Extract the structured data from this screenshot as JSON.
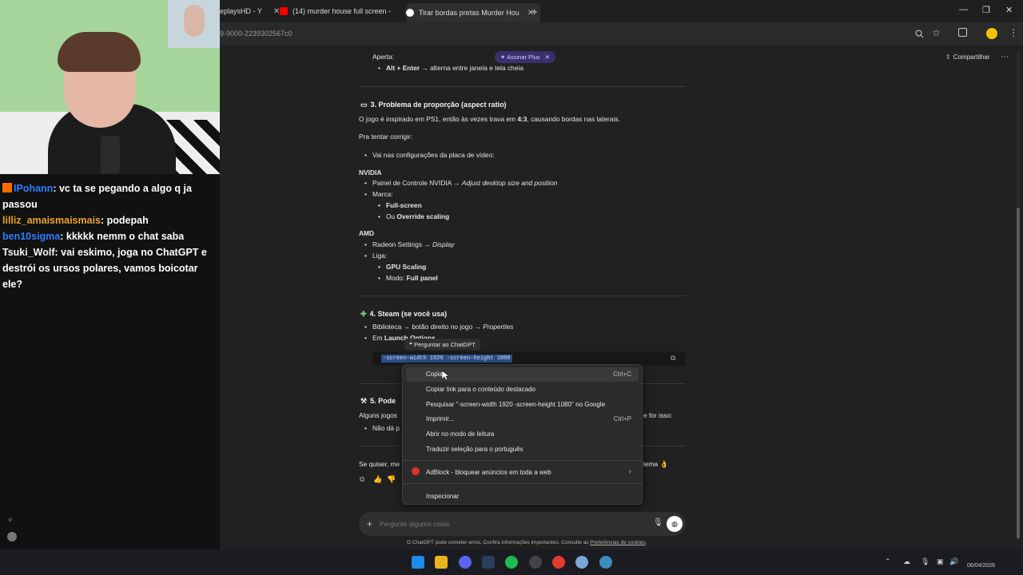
{
  "browser": {
    "tabs": [
      {
        "label": "eplaysHD - Y",
        "close": "✕"
      },
      {
        "label": "(14) murder house full screen -",
        "close": "✕"
      },
      {
        "label": "Tirar bordas pretas Murder Hou",
        "close": "✕"
      }
    ],
    "new_tab": "+",
    "url": "9-9000-2239302567c0",
    "window": {
      "minimize": "—",
      "restore": "❐",
      "close": "✕"
    }
  },
  "header": {
    "plus_pill": "✦ Assinar Plus",
    "plus_close": "✕",
    "share": "Compartilhar",
    "more": "⋯"
  },
  "content": {
    "aperta": "Aperta:",
    "alt_enter_keys": "Alt + Enter",
    "alt_enter_rest": " → alterna entre janela e tela cheia",
    "s3_title": "3. Problema de proporção (aspect ratio)",
    "s3_p1_a": "O jogo é inspirado em PS1, então às vezes trava em ",
    "s3_p1_b": "4:3",
    "s3_p1_c": ", causando bordas nas laterais.",
    "s3_p2": "Pra tentar corrigir:",
    "s3_b1": "Vai nas configurações da placa de vídeo:",
    "nvidia": "NVIDIA",
    "nv_b1_a": "Painel de Controle NVIDIA → ",
    "nv_b1_b": "Adjust desktop size and position",
    "nv_b2": "Marca:",
    "nv_b2_1": "Full-screen",
    "nv_b2_2_a": "Ou ",
    "nv_b2_2_b": "Override scaling",
    "amd": "AMD",
    "amd_b1_a": "Radeon Settings → ",
    "amd_b1_b": "Display",
    "amd_b2": "Liga:",
    "amd_b2_1": "GPU Scaling",
    "amd_b2_2_a": "Modo: ",
    "amd_b2_2_b": "Full panel",
    "s4_title": "4. Steam (se você usa)",
    "s4_b1_a": "Biblioteca → botão direito no jogo → ",
    "s4_b1_b": "Properties",
    "s4_b2_a": "Em ",
    "s4_b2_b": "Launch Options",
    "code": "-screen-width 1920 -screen-height 1080",
    "s5_title": "5. Pode",
    "s5_p1": "Alguns jogos",
    "s5_p1_end": "e for isso:",
    "s5_b1": "Não dá p",
    "final_a": "Se quiser, me",
    "final_b": "lema 👌"
  },
  "ask_popup": "❝ Perguntar ao ChatGPT",
  "context_menu": {
    "items": [
      {
        "label": "Copiar",
        "shortcut": "Ctrl+C"
      },
      {
        "label": "Copiar link para o conteúdo destacado",
        "shortcut": ""
      },
      {
        "label": "Pesquisar \"-screen-width 1920 -screen-height 1080\" no Google",
        "shortcut": ""
      },
      {
        "label": "Imprimir...",
        "shortcut": "Ctrl+P"
      },
      {
        "label": "Abrir no modo de leitura",
        "shortcut": ""
      },
      {
        "label": "Traduzir seleção para o português",
        "shortcut": ""
      },
      {
        "label": "AdBlock - bloquear anúncios em toda a web",
        "shortcut": "›"
      },
      {
        "label": "Inspecionar",
        "shortcut": ""
      }
    ]
  },
  "input": {
    "placeholder": "Pergunte alguma coisa"
  },
  "footer": {
    "text": "O ChatGPT pode cometer erros. Confira informações importantes. Consulte as ",
    "link": "Preferências de cookies",
    "end": "."
  },
  "taskbar": {
    "date": "06/04/2026"
  },
  "stream_chat": [
    {
      "user": "IPohann",
      "color": "#2e7dff",
      "text": ": vc ta se pegando a algo q ja passou"
    },
    {
      "user": "lilliz_amaismaismais",
      "color": "#e9a22f",
      "text": ": podepah"
    },
    {
      "user": "ben10sigma",
      "color": "#2e7dff",
      "text": ": kkkkk nemm o chat saba"
    },
    {
      "user": "Tsuki_Wolf",
      "color": "#f3f3f3",
      "text": ": vai eskimo, joga no ChatGPT e destrói os ursos polares, vamos boicotar ele?"
    }
  ],
  "colors": {
    "accent_purple": "#3b2f6e",
    "selection": "#2c4f8a",
    "bg": "#212121"
  }
}
